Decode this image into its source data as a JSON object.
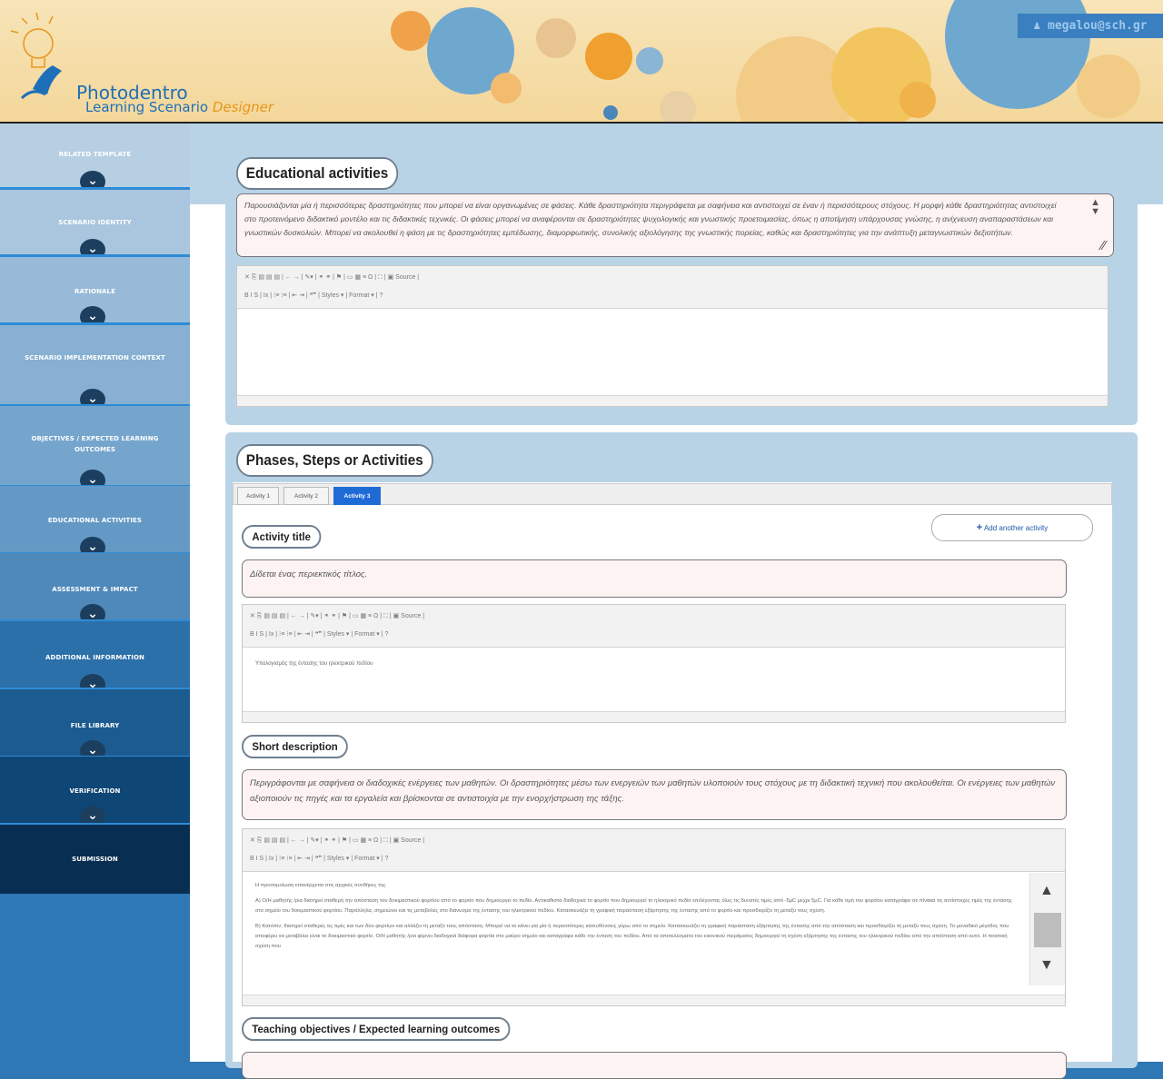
{
  "header": {
    "logo_title": "Photodentro",
    "logo_subtitle": "Learning Scenario",
    "logo_subtitle_accent": "Designer",
    "user_email": "megalou@sch.gr",
    "user_icon": "user-icon"
  },
  "sidebar": {
    "items": [
      {
        "label": "RELATED TEMPLATE"
      },
      {
        "label": "SCENARIO IDENTITY"
      },
      {
        "label": "RATIONALE"
      },
      {
        "label": "SCENARIO IMPLEMENTATION CONTEXT"
      },
      {
        "label": "OBJECTIVES / EXPECTED LEARNING OUTCOMES"
      },
      {
        "label": "EDUCATIONAL ACTIVITIES"
      },
      {
        "label": "ASSESSMENT & IMPACT"
      },
      {
        "label": "ADDITIONAL INFORMATION"
      },
      {
        "label": "FILE LIBRARY"
      },
      {
        "label": "VERIFICATION"
      },
      {
        "label": "SUBMISSION"
      }
    ]
  },
  "educational": {
    "title": "Educational activities",
    "help": "Παρουσιάζονται μία ή περισσότερες δραστηριότητες που μπορεί να είναι οργανωμένες σε φάσεις. Κάθε δραστηριότητα περιγράφεται με σαφήνεια και αντιστοιχεί σε έναν ή περισσότερους στόχους. Η μορφή κάθε δραστηριότητας αντιστοιχεί στο προτεινόμενο διδακτικό μοντέλο και τις διδακτικές τεχνικές. Οι φάσεις μπορεί να αναφέρονται σε δραστηριότητες ψυχολογικής και γνωστικής προετοιμασίας, όπως η αποτίμηση υπάρχουσας γνώσης, η ανίχνευση αναπαραστάσεων και γνωστικών δυσκολιών. Μπορεί να ακολουθεί η φάση με τις δραστηριότητες εμπέδωσης, διαμορφωτικής, συνολικής αξιολόγησης της γνωστικής πορείας, καθώς και δραστηριότητες για την ανάπτυξη μεταγνωστικών δεξιοτήτων."
  },
  "toolbar": {
    "row1": "✕ ⎘  ▤  ▤  ▤ | ← → | ✎▾ | ⚭  ⚭ | ⚑ | ▭  ▦  ≡  Ω | ⛶ | ▣ Source |",
    "row2": "B  I  S | Ix | ⁝≡  ⁝≡ | ⇤  ⇥ | ❝❞ |   Styles      ▾ |   Format      ▾ | ?"
  },
  "phases": {
    "title": "Phases, Steps or Activities",
    "tabs": [
      "Activity 1",
      "Activity 2",
      "Activity 3"
    ],
    "active_tab": "Activity 3",
    "add_button": "Add another activity",
    "activity_title_label": "Activity title",
    "activity_title_help": "Δίδεται ένας περιεκτικός τίτλος.",
    "activity_title_value": "Υπολογισμός της έντασης του ηλεκτρικού πεδίου",
    "short_desc_label": "Short description",
    "short_desc_help": "Περιγράφονται με σαφήνεια οι διαδοχικές ενέργειες των μαθητών. Οι δραστηριότητες μέσω των ενεργειών των μαθητών υλοποιούν τους στόχους με τη διδακτική τεχνική που ακολουθείται. Οι ενέργειες των μαθητών αξιοποιούν τις πηγές και τα εργαλεία και βρίσκονται σε αντιστοιχία με την ενορχήστρωση της τάξης.",
    "short_desc_body": [
      "Η προσομοίωση επανέρχεται στις αρχικές συνθήκες της.",
      "Α) Ο/Η μαθητής /ρια διατηρεί σταθερή την απόσταση του δοκιμαστικού φορτίου από το φορτίο που δημιουργεί το πεδίο. Αντικαθιστά διαδοχικά το φορτίο που δημιουργεί το ηλεκτρικό πεδίο επιλέγοντας όλες τις δυνατές τιμές από -5μC μέχρι 5μC. Για κάθε τιμή του φορτίου καταγράφει σε πίνακα τις αντίστοιχες τιμές της έντασης στο σημείο του δοκιμαστικού φορτίου. Παράλληλα, σημειώνει και τις μεταβολές στο διάνυσμα της έντασης του ηλεκτρικού πεδίου. Κατασκευάζει τη γραφική παράσταση εξάρτησης της έντασης από το φορτίο και προσδιορίζει τη μεταξύ τους σχέση.",
      "Β) Κατόπιν, διατηρεί σταθερές τις τιμές και των δύο φορτίων και αλλάζει τη μεταξύ τους απόσταση. Μπορεί να το κάνει για μία ή περισσότερες κατευθύνσεις γύρω από το σημείο. Κατασκευάζει τη γραφική παράσταση εξάρτησης της έντασης από την απόσταση και προσδιορίζει τη μεταξύ τους σχέση. Το μοναδικό μέγεθος που αποφέρει να μεταβάλει είναι το δοκιμαστικό φορτίο. Ο/Η μαθητής /ρια φέρνει διαδοχικά διάφορα φορτία στο μαύρο σημείο και καταγράφει κάθε την ένταση του πεδίου. Από τα αποτελέσματα του εικονικού πειράματος δημιουργεί τη σχέση εξάρτησης της έντασης του ηλεκτρικού πεδίου από την απόσταση από αυτό. Η ποιοτική σχέση που"
    ],
    "objectives_label": "Teaching objectives / Expected learning outcomes"
  }
}
